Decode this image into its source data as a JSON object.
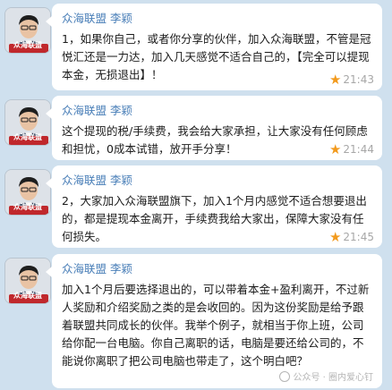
{
  "messages": [
    {
      "sender": "众海联盟 李颖",
      "avatar_label": "众海联盟",
      "text": "1，如果你自己，或者你分享的伙伴，加入众海联盟，不管是冠悦汇还是一力达，加入几天感觉不适合自己的，【完全可以提现本金，无损退出】！",
      "time": "21:43"
    },
    {
      "sender": "众海联盟 李颖",
      "avatar_label": "众海联盟",
      "text": "这个提现的税/手续费，我会给大家承担，让大家没有任何顾虑和担忧，0成本试错，放开手分享！",
      "time": "21:44"
    },
    {
      "sender": "众海联盟 李颖",
      "avatar_label": "众海联盟",
      "text": "2，大家加入众海联盟旗下，加入1个月内感觉不适合想要退出的，都是提现本金离开，手续费我给大家出，保障大家没有任何损失。",
      "time": "21:45"
    },
    {
      "sender": "众海联盟 李颖",
      "avatar_label": "众海联盟",
      "text": "加入1个月后要选择退出的，可以带着本金+盈利离开，不过新人奖励和介绍奖励之类的是会收回的。因为这份奖励是给予跟着联盟共同成长的伙伴。我举个例子，就相当于你上班，公司给你配一台电脑。你自己离职的话，电脑是要还给公司的，不能说你离职了把公司电脑也带走了，这个明白吧？",
      "time": ""
    }
  ],
  "watermark": "公众号 · 圈内爱心钉",
  "colors": {
    "background": "#cfe0ee",
    "sender": "#4a7fb8",
    "star": "#f29a1d",
    "timestamp": "#a7a7a7"
  },
  "icons": {
    "favorite": "star-icon",
    "avatar": "person-avatar-icon"
  }
}
